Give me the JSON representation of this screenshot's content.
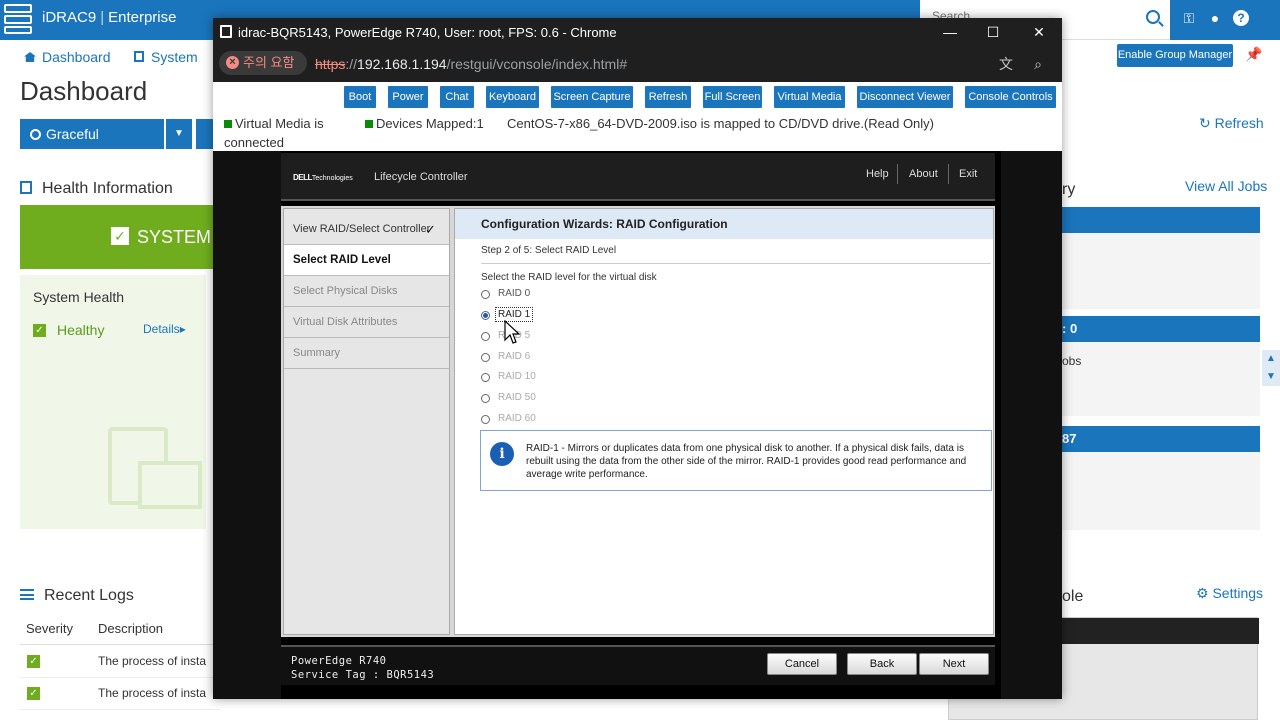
{
  "idrac": {
    "brand_name": "iDRAC9",
    "edition": "Enterprise",
    "search_placeholder": "Search",
    "nav": {
      "dashboard": "Dashboard",
      "system": "System"
    },
    "enable_group_manager": "Enable Group Manager",
    "page_title": "Dashboard",
    "graceful_shutdown": "Graceful Shutdown",
    "refresh": "Refresh",
    "health_information": "Health Information",
    "system_banner": "SYSTEM",
    "system_health": "System Health",
    "healthy": "Healthy",
    "details": "Details",
    "recent_logs": "Recent Logs",
    "logs_columns": {
      "severity": "Severity",
      "description": "Description"
    },
    "log_rows": [
      {
        "description": "The process of insta"
      },
      {
        "description": "The process of insta"
      }
    ],
    "right_panel": {
      "summary_partial": "ry",
      "view_all_jobs": "View All Jobs",
      "jobs_count": ": 0",
      "jobs_text": "obs",
      "bar_value": "87",
      "settings": "Settings",
      "console_partial": "ole"
    }
  },
  "chrome": {
    "window_title": "idrac-BQR5143, PowerEdge R740, User: root, FPS: 0.6 - Chrome",
    "security_chip": "주의 요함",
    "url_scheme": "https",
    "url_host": "192.168.1.194",
    "url_path": "/restgui/vconsole/index.html#"
  },
  "vconsole": {
    "toolbar": [
      "Boot",
      "Power",
      "Chat",
      "Keyboard",
      "Screen Capture",
      "Refresh",
      "Full Screen",
      "Virtual Media",
      "Disconnect Viewer",
      "Console Controls"
    ],
    "vm_status_line1": "Virtual Media is",
    "vm_status_line2": "connected",
    "devices_mapped": "Devices Mapped:1",
    "mapped_info": "CentOS-7-x86_64-DVD-2009.iso is mapped to CD/DVD drive.(Read Only)"
  },
  "lifecycle": {
    "dell_logo_bold": "DELL",
    "dell_logo_rest": "Technologies",
    "app_name": "Lifecycle Controller",
    "menu": {
      "help": "Help",
      "about": "About",
      "exit": "Exit"
    },
    "steps": [
      {
        "label": "View RAID/Select Controller",
        "state": "done"
      },
      {
        "label": "Select RAID Level",
        "state": "active"
      },
      {
        "label": "Select Physical Disks",
        "state": "pending"
      },
      {
        "label": "Virtual Disk Attributes",
        "state": "pending"
      },
      {
        "label": "Summary",
        "state": "pending"
      }
    ],
    "wizard_title": "Configuration Wizards: RAID Configuration",
    "wizard_step": "Step 2 of 5: Select RAID Level",
    "wizard_prompt": "Select the RAID level for the virtual disk",
    "raid_options": [
      "RAID 0",
      "RAID 1",
      "RAID 5",
      "RAID 6",
      "RAID 10",
      "RAID 50",
      "RAID 60"
    ],
    "raid_selected": "RAID 1",
    "info_text": "RAID-1 - Mirrors or duplicates data from one physical disk to another. If a physical disk fails, data is rebuilt using the data from the other side of the mirror. RAID-1 provides good read performance and average write performance.",
    "system_model": "PowerEdge R740",
    "service_tag": "Service Tag : BQR5143",
    "buttons": {
      "cancel": "Cancel",
      "back": "Back",
      "next": "Next"
    }
  },
  "colors": {
    "idrac_blue": "#1a75bc",
    "health_green": "#6fad1f",
    "chrome_dark": "#1f1f1f",
    "security_warning": "#f28b82"
  }
}
